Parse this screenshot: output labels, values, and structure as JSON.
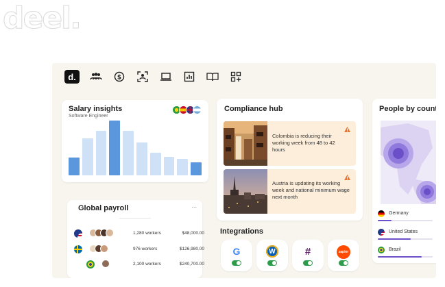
{
  "brand": {
    "logo": "deel.",
    "app_mark": "d."
  },
  "toolbar": {
    "icons": [
      "people-icon",
      "dollar-icon",
      "id-scan-icon",
      "laptop-icon",
      "chart-icon",
      "book-icon",
      "apps-icon"
    ]
  },
  "salary": {
    "title": "Salary insights",
    "subtitle": "Software Engineer",
    "flags": [
      "brazil",
      "spain",
      "uk",
      "argentina"
    ],
    "chart_data": {
      "type": "bar",
      "values": [
        28,
        58,
        70,
        86,
        70,
        52,
        35,
        29,
        26,
        20
      ],
      "highlight": [
        0,
        3,
        9
      ]
    }
  },
  "compliance": {
    "title": "Compliance hub",
    "items": [
      {
        "text": "Colombia is reducing their working week from 48 to 42 hours"
      },
      {
        "text": "Austria is updating its working week and national minimum wage next month"
      }
    ]
  },
  "map": {
    "title": "People by countr",
    "countries": [
      {
        "name": "Germany",
        "progress": 0.25
      },
      {
        "name": "United States",
        "progress": 0.6
      },
      {
        "name": "Brazil",
        "progress": 0.8
      }
    ]
  },
  "payroll": {
    "title": "Global payroll",
    "more": "...",
    "rows": [
      {
        "workers": "1,280 workers",
        "amount": "$48,000.00"
      },
      {
        "workers": "976 workers",
        "amount": "$126,980.00"
      },
      {
        "workers": "2,100 workers",
        "amount": "$240,700.00"
      }
    ]
  },
  "integrations": {
    "title": "Integrations",
    "apps": [
      {
        "name": "google",
        "label": "G",
        "color": "#4285f4"
      },
      {
        "name": "w-app",
        "label": "W",
        "color": "#ffffff",
        "bg": "#0b5fb5"
      },
      {
        "name": "slack",
        "label": "#",
        "color": "#611f69"
      },
      {
        "name": "zapier",
        "label": "zapier",
        "color": "#ffffff",
        "bg": "#ff4a00"
      }
    ]
  }
}
